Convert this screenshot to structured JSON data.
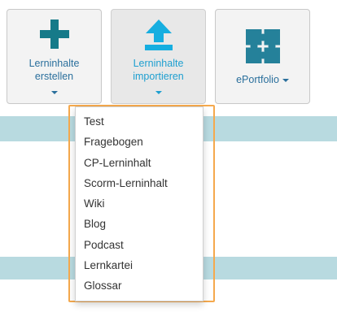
{
  "toolbar": {
    "create": {
      "label_line1": "Lerninhalte",
      "label_line2": "erstellen",
      "icon": "plus-icon"
    },
    "import": {
      "label_line1": "Lerninhalte",
      "label_line2": "importieren",
      "icon": "upload-icon"
    },
    "portfolio": {
      "label": "ePortfolio",
      "icon": "puzzle-icon"
    }
  },
  "import_menu": {
    "items": [
      {
        "label": "Test"
      },
      {
        "label": "Fragebogen"
      },
      {
        "label": "CP-Lerninhalt"
      },
      {
        "label": "Scorm-Lerninhalt"
      },
      {
        "label": "Wiki"
      },
      {
        "label": "Blog"
      },
      {
        "label": "Podcast"
      },
      {
        "label": "Lernkartei"
      },
      {
        "label": "Glossar"
      }
    ]
  },
  "colors": {
    "plus": "#167a89",
    "upload": "#16aee0",
    "puzzle": "#25819a",
    "link": "#2a6f9c",
    "link_active": "#1e9fd0",
    "band": "#b8dae0",
    "highlight": "#f5a94d"
  }
}
